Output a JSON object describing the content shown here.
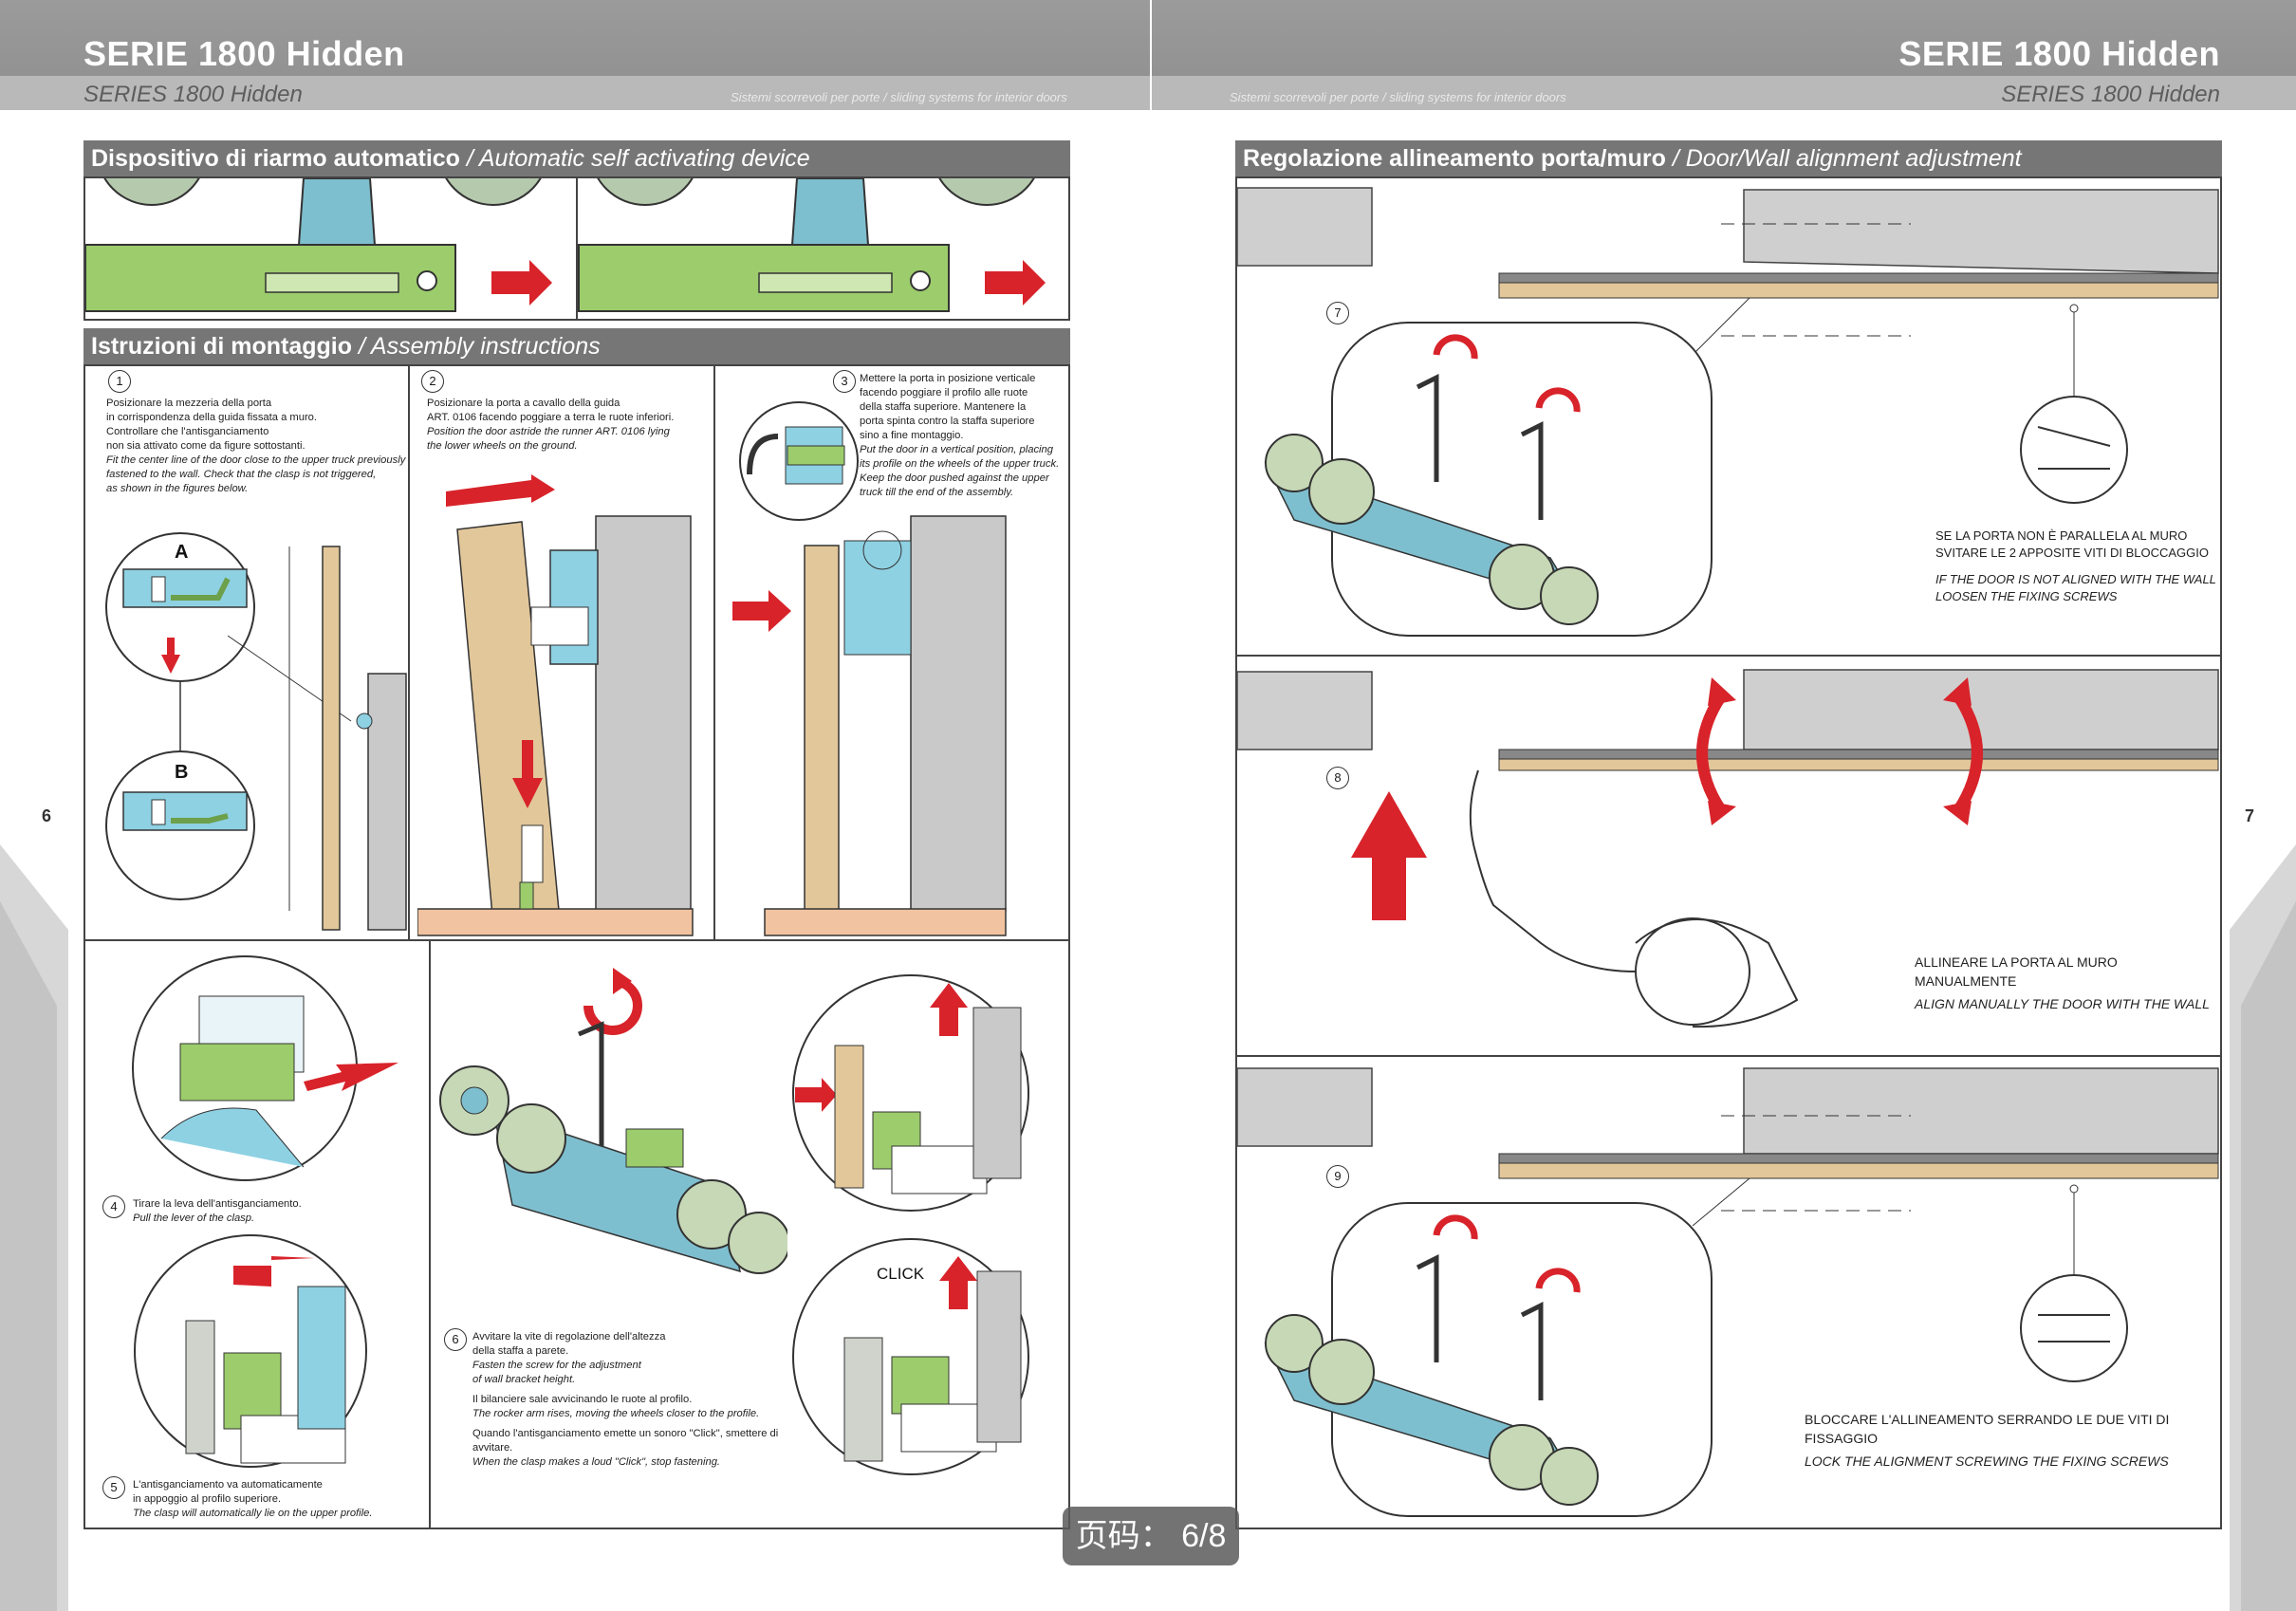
{
  "header": {
    "left_title": "SERIE 1800 Hidden",
    "left_subtitle": "SERIES 1800 Hidden",
    "left_tagline": "Sistemi scorrevoli per porte / sliding systems for interior doors",
    "right_title": "SERIE 1800 Hidden",
    "right_subtitle": "SERIES 1800 Hidden",
    "right_tagline": "Sistemi scorrevoli per porte / sliding systems for interior doors"
  },
  "left_page": {
    "page_number": "6",
    "section1": {
      "title_it": "Dispositivo di riarmo automatico",
      "title_en": "/ Automatic self activating device"
    },
    "section2": {
      "title_it": "Istruzioni di montaggio",
      "title_en": "/ Assembly instructions"
    },
    "steps": [
      {
        "num": "1",
        "it": [
          "Posizionare la mezzeria della porta",
          "in corrispondenza della guida fissata a muro.",
          "Controllare che l'antisganciamento",
          "non sia attivato come da figure sottostanti."
        ],
        "en": [
          "Fit the center line of the door close to the upper truck previously",
          "fastened to the wall. Check that the clasp is not triggered,",
          "as shown in the figures below."
        ],
        "labels": [
          "A",
          "B"
        ]
      },
      {
        "num": "2",
        "it": [
          "Posizionare la porta a cavallo della guida",
          "ART. 0106 facendo poggiare a terra le ruote inferiori."
        ],
        "en": [
          "Position the door astride the runner ART. 0106 lying",
          "the lower wheels on the ground."
        ]
      },
      {
        "num": "3",
        "it": [
          "Mettere la porta in posizione verticale",
          "facendo poggiare il profilo alle ruote",
          "della staffa superiore. Mantenere la",
          "porta spinta contro la staffa superiore",
          "sino a fine montaggio."
        ],
        "en": [
          "Put the door in a vertical position, placing",
          "its profile on the wheels of the upper truck.",
          "Keep the door pushed against the upper",
          "truck till the end of the assembly."
        ]
      },
      {
        "num": "4",
        "it": [
          "Tirare la leva dell'antisganciamento."
        ],
        "en": [
          "Pull the lever of the clasp."
        ]
      },
      {
        "num": "5",
        "it": [
          "L'antisganciamento va automaticamente",
          "in appoggio al profilo superiore."
        ],
        "en": [
          "The clasp will automatically lie on the upper profile."
        ]
      },
      {
        "num": "6",
        "it1": [
          "Avvitare la vite di regolazione dell'altezza",
          "della staffa a parete."
        ],
        "en1": [
          "Fasten the screw for the adjustment",
          "of wall bracket height."
        ],
        "it2": [
          "Il bilanciere sale avvicinando le ruote al profilo."
        ],
        "en2": [
          "The rocker arm rises, moving the wheels closer to the profile."
        ],
        "it3": [
          "Quando l'antisganciamento emette un sonoro \"Click\", smettere di avvitare."
        ],
        "en3": [
          "When the clasp makes a loud \"Click\", stop fastening."
        ],
        "click_label": "CLICK"
      }
    ]
  },
  "right_page": {
    "page_number": "7",
    "section": {
      "title_it": "Regolazione allineamento porta/muro",
      "title_en": "/  Door/Wall alignment adjustment"
    },
    "steps": [
      {
        "num": "7",
        "it": "SE LA PORTA NON È PARALLELA AL MURO",
        "it2": "SVITARE LE 2 APPOSITE VITI DI BLOCCAGGIO",
        "en": "IF THE DOOR IS NOT ALIGNED WITH THE WALL",
        "en2": "LOOSEN THE FIXING SCREWS"
      },
      {
        "num": "8",
        "it": "ALLINEARE LA PORTA AL MURO MANUALMENTE",
        "en": "ALIGN MANUALLY THE DOOR WITH THE WALL"
      },
      {
        "num": "9",
        "it": "BLOCCARE L'ALLINEAMENTO SERRANDO LE DUE VITI DI FISSAGGIO",
        "en": "LOCK THE ALIGNMENT SCREWING THE FIXING SCREWS"
      }
    ]
  },
  "overlay": {
    "page_badge": "页码： 6/8"
  },
  "colors": {
    "header": "#949494",
    "bar": "#767676",
    "accent_red": "#d8232a",
    "device_green": "#8cc05a",
    "device_teal": "#6fb3c3",
    "wood": "#e2c79a",
    "wall": "#c9c9c9"
  }
}
